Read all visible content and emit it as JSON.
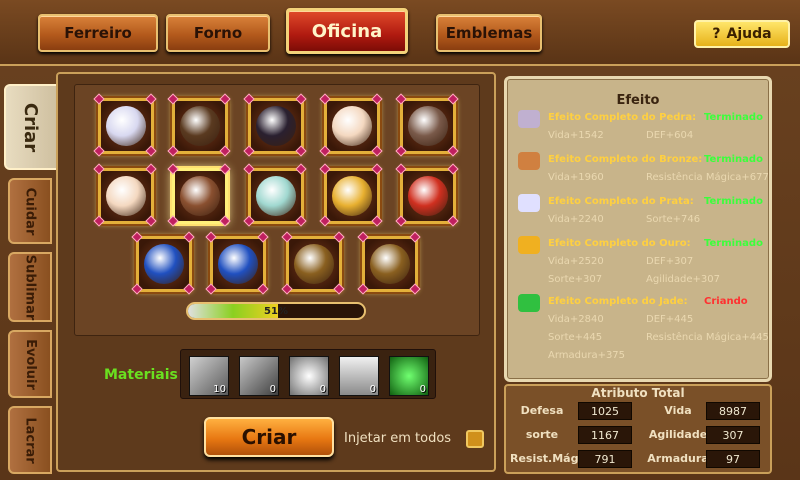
{
  "top_tabs": [
    {
      "label": "Ferreiro",
      "active": false
    },
    {
      "label": "Forno",
      "active": false
    },
    {
      "label": "Oficina",
      "active": true
    },
    {
      "label": "Emblemas",
      "active": false
    }
  ],
  "help_button": {
    "label": "Ajuda",
    "icon": "question-icon"
  },
  "side_tabs": [
    {
      "label": "Criar",
      "active": true
    },
    {
      "label": "Cuidar",
      "active": false
    },
    {
      "label": "Sublimar",
      "active": false
    },
    {
      "label": "Evoluir",
      "active": false
    },
    {
      "label": "Lacrar",
      "active": false
    }
  ],
  "craft_slots": [
    {
      "icon": "costume-hat-icon"
    },
    {
      "icon": "glasses-icon"
    },
    {
      "icon": "hair-icon"
    },
    {
      "icon": "face-icon"
    },
    {
      "icon": "weapon-icon"
    },
    {
      "icon": "face-icon"
    },
    {
      "icon": "chibi-head-icon",
      "selected": true
    },
    {
      "icon": "wings-icon"
    },
    {
      "icon": "necklace-icon"
    },
    {
      "icon": "ring-icon"
    },
    {
      "icon": "ring-blue-icon"
    },
    {
      "icon": "ring-blue-icon"
    },
    {
      "icon": "ring-gold-icon"
    },
    {
      "icon": "ring-gold-icon"
    }
  ],
  "progress": {
    "value": 0.51,
    "label": "51%"
  },
  "materials": {
    "label": "Materiais",
    "items": [
      {
        "icon": "stone-icon",
        "count": "10"
      },
      {
        "icon": "bronze-icon",
        "count": "0"
      },
      {
        "icon": "silver-icon",
        "count": "0"
      },
      {
        "icon": "gold-icon",
        "count": "0"
      },
      {
        "icon": "jade-icon",
        "count": "0"
      }
    ]
  },
  "craft_button": "Criar",
  "inject_all_label": "Injetar em todos",
  "effects": {
    "title": "Efeito",
    "rows": [
      {
        "icon": "stone-icon",
        "name": "Efeito Completo do Pedra:",
        "status": "Terminado",
        "stats": [
          "Vida+1542",
          "DEF+604"
        ]
      },
      {
        "icon": "bronze-icon",
        "name": "Efeito Completo do  Bronze:",
        "status": "Terminado",
        "stats": [
          "Vida+1960",
          "Resistência Mágica+677"
        ]
      },
      {
        "icon": "silver-icon",
        "name": "Efeito Completo do  Prata:",
        "status": "Terminado",
        "stats": [
          "Vida+2240",
          "Sorte+746"
        ]
      },
      {
        "icon": "gold-icon",
        "name": "Efeito Completo do  Ouro:",
        "status": "Terminado",
        "stats": [
          "Vida+2520",
          "DEF+307",
          "Sorte+307",
          "Agilidade+307"
        ]
      },
      {
        "icon": "jade-icon",
        "name": "Efeito Completo do  Jade:",
        "status": "Criando",
        "stats": [
          "Vida+2840",
          "DEF+445",
          "Sorte+445",
          "Resistência Mágica+445",
          "Armadura+375"
        ]
      }
    ],
    "status_colors": {
      "Terminado": "#3cff3c",
      "Criando": "#ff3030"
    }
  },
  "total_attributes": {
    "title": "Atributo Total",
    "rows": [
      [
        {
          "name": "Defesa",
          "value": "1025"
        },
        {
          "name": "Vida",
          "value": "8987"
        }
      ],
      [
        {
          "name": "sorte",
          "value": "1167"
        },
        {
          "name": "Agilidade",
          "value": "307"
        }
      ],
      [
        {
          "name": "Resist.Mág.",
          "value": "791"
        },
        {
          "name": "Armadura",
          "value": "97"
        }
      ]
    ]
  }
}
